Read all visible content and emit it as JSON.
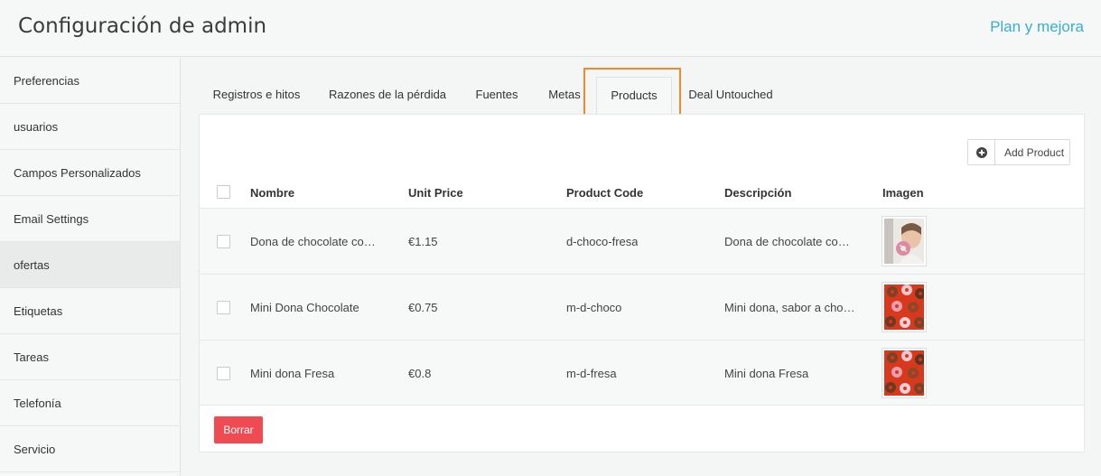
{
  "header": {
    "title": "Configuración de admin",
    "upgrade_link": "Plan y mejora"
  },
  "sidebar": {
    "items": [
      {
        "label": "Preferencias"
      },
      {
        "label": "usuarios"
      },
      {
        "label": "Campos Personalizados"
      },
      {
        "label": "Email Settings"
      },
      {
        "label": "ofertas",
        "active": true
      },
      {
        "label": "Etiquetas"
      },
      {
        "label": "Tareas"
      },
      {
        "label": "Telefonía"
      },
      {
        "label": "Servicio"
      }
    ]
  },
  "tabs": [
    {
      "label": "Registros e hitos"
    },
    {
      "label": "Razones de la pérdida"
    },
    {
      "label": "Fuentes"
    },
    {
      "label": "Metas"
    },
    {
      "label": "Products",
      "active": true
    },
    {
      "label": "Deal Untouched"
    }
  ],
  "toolbar": {
    "add_product_label": "Add Product",
    "add_icon": "plus-circle-icon"
  },
  "table": {
    "columns": [
      "Nombre",
      "Unit Price",
      "Product Code",
      "Descripción",
      "Imagen"
    ],
    "rows": [
      {
        "name": "Dona de chocolate con fresa",
        "unit_price": "€1.15",
        "code": "d-choco-fresa",
        "description": "Dona de chocolate con fresa",
        "image": "girl-holding-donut"
      },
      {
        "name": "Mini Dona Chocolate",
        "unit_price": "€0.75",
        "code": "m-d-choco",
        "description": "Mini dona, sabor a chocolate",
        "image": "donuts-on-red"
      },
      {
        "name": "Mini dona Fresa",
        "unit_price": "€0.8",
        "code": "m-d-fresa",
        "description": "Mini dona Fresa",
        "image": "donuts-on-red"
      }
    ]
  },
  "actions": {
    "delete_label": "Borrar"
  },
  "colors": {
    "accent": "#3aaed1",
    "danger": "#ef4b52",
    "highlight": "#f28732"
  }
}
